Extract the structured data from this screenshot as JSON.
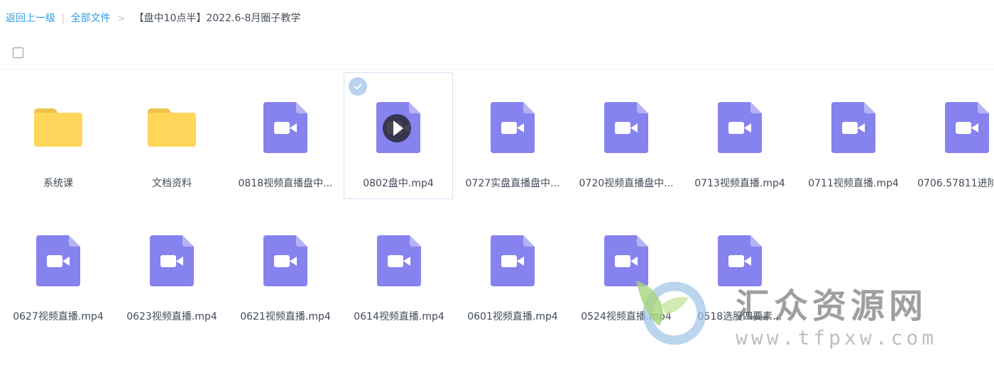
{
  "breadcrumb": {
    "back": "返回上一级",
    "separator": "|",
    "all_files": "全部文件",
    "arrow": ">",
    "current": "【盘中10点半】2022.6-8月圈子教学"
  },
  "files": {
    "row1": [
      {
        "type": "folder",
        "name": "系统课"
      },
      {
        "type": "folder",
        "name": "文档资料"
      },
      {
        "type": "video",
        "name": "0818视频直播盘中..."
      },
      {
        "type": "video",
        "name": "0802盘中.mp4",
        "selected": true
      },
      {
        "type": "video",
        "name": "0727实盘直播盘中..."
      },
      {
        "type": "video",
        "name": "0720视频直播盘中..."
      },
      {
        "type": "video",
        "name": "0713视频直播.mp4"
      },
      {
        "type": "video",
        "name": "0711视频直播.mp4"
      },
      {
        "type": "video",
        "name": "0706.57811进阶"
      }
    ],
    "row2": [
      {
        "type": "video",
        "name": "0627视频直播.mp4"
      },
      {
        "type": "video",
        "name": "0623视频直播.mp4"
      },
      {
        "type": "video",
        "name": "0621视频直播.mp4"
      },
      {
        "type": "video",
        "name": "0614视频直播.mp4"
      },
      {
        "type": "video",
        "name": "0601视频直播.mp4"
      },
      {
        "type": "video",
        "name": "0524视频直播.mp4"
      },
      {
        "type": "video",
        "name": "0518选股四要素..."
      }
    ]
  },
  "watermark": {
    "title": "汇众资源网",
    "url": "www.tfpxw.com"
  },
  "colors": {
    "link": "#2f9ae6",
    "folder": "#ffd659",
    "video_icon": "#8682ee",
    "selected_border": "#cfe3f5"
  },
  "icons": {
    "folder": "folder-icon",
    "video": "video-file-icon",
    "play": "play-icon",
    "check": "check-icon"
  }
}
